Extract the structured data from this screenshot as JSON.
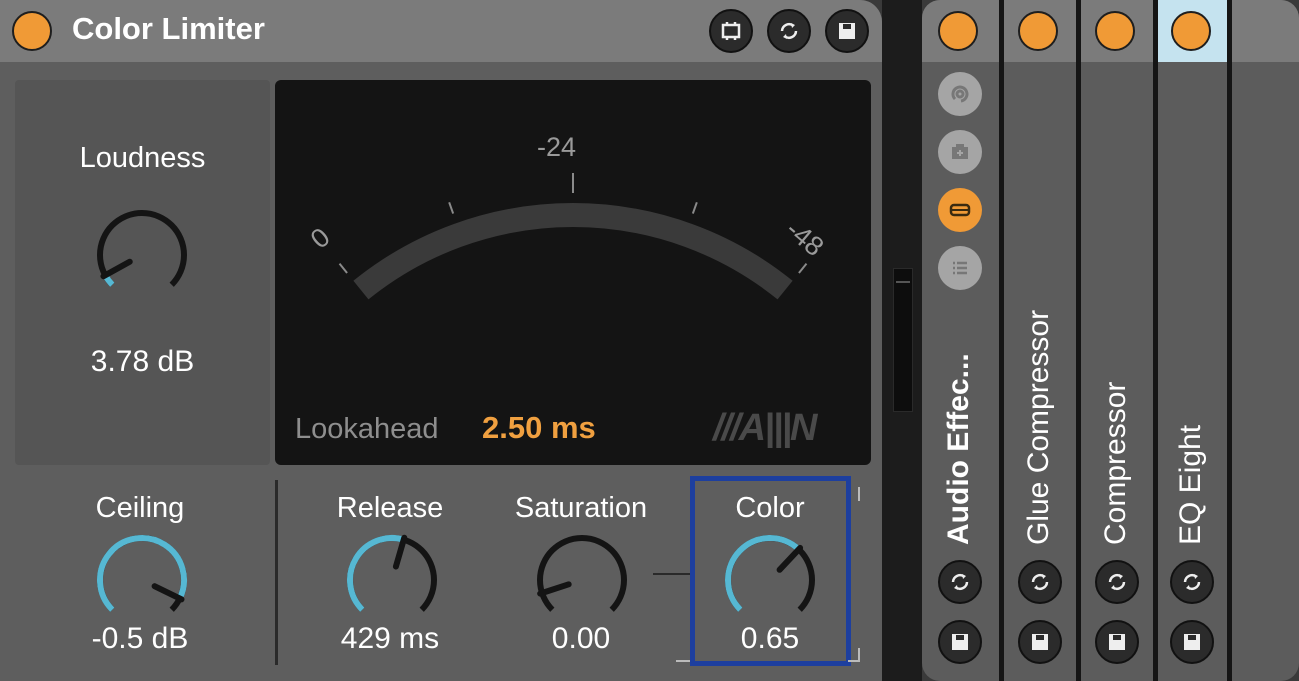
{
  "device": {
    "title": "Color Limiter",
    "header_buttons": [
      {
        "icon": "hot-swap-icon"
      },
      {
        "icon": "refresh-icon"
      },
      {
        "icon": "save-icon"
      }
    ],
    "loudness": {
      "label": "Loudness",
      "value": "3.78 dB",
      "position": 0.06,
      "fill": 0.06
    },
    "meter": {
      "scale": [
        "0",
        "-24",
        "-48"
      ],
      "lookahead_label": "Lookahead",
      "lookahead_value": "2.50 ms",
      "logo": "///A|||N"
    },
    "ceiling": {
      "label": "Ceiling",
      "value": "-0.5 dB",
      "position": 0.93,
      "fill": 0.93
    },
    "release": {
      "label": "Release",
      "value": "429 ms",
      "position": 0.56,
      "fill": 0.56
    },
    "saturation": {
      "label": "Saturation",
      "value": "0.00",
      "position": 0.1,
      "fill": 0
    },
    "color": {
      "label": "Color",
      "value": "0.65",
      "position": 0.66,
      "fill": 0.66
    }
  },
  "colors": {
    "accent": "#f09a36",
    "knob_fill": "#56b8d3",
    "focus": "#1d3f9f",
    "selected_header": "#c5e3ef"
  },
  "chain": {
    "side_icons": [
      "chain-icon",
      "add-device-icon",
      "macro-icon",
      "list-icon"
    ],
    "items": [
      {
        "label": "Audio Effec..."
      },
      {
        "label": "Glue Compressor"
      },
      {
        "label": "Compressor"
      },
      {
        "label": "EQ Eight",
        "selected": true
      }
    ]
  }
}
